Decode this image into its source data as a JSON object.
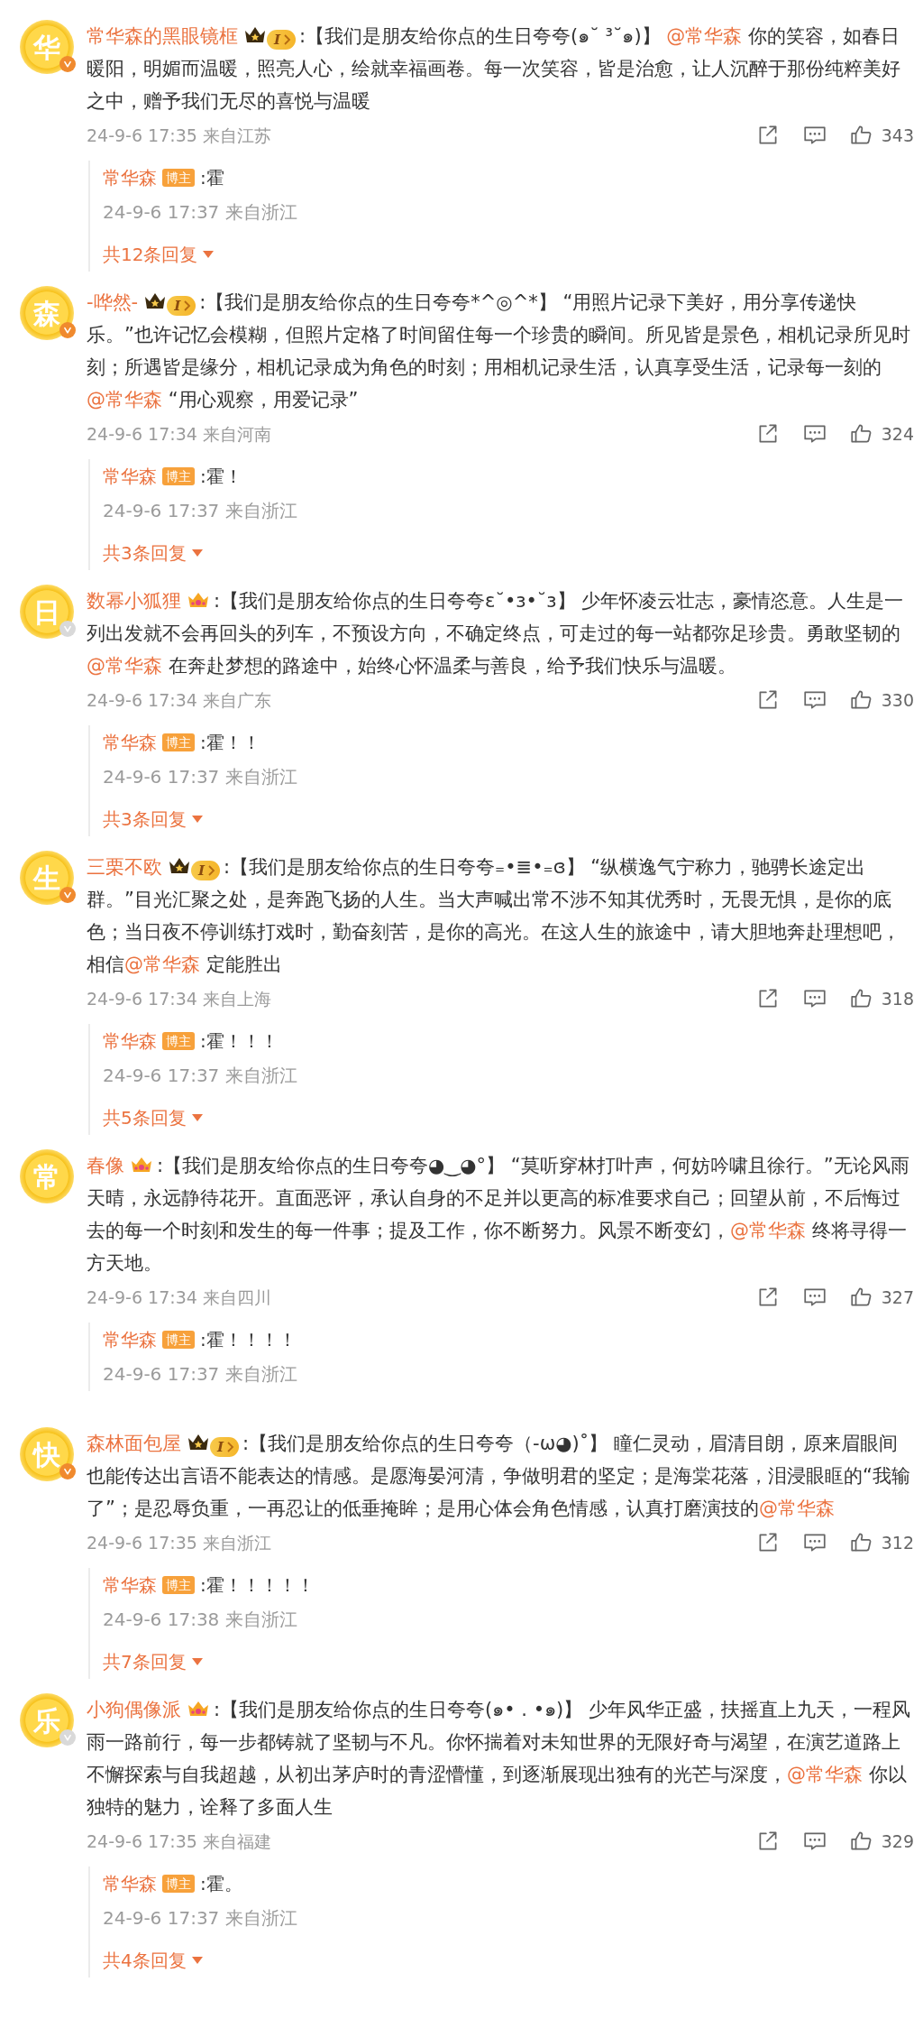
{
  "comments": [
    {
      "avatar": "华",
      "verified": {
        "color": "#f08a2e"
      },
      "name": "常华森的黑眼镜框",
      "badge": {
        "kind": "level",
        "label": "I"
      },
      "body": [
        {
          "kind": "text",
          "text": ":【我们是朋友给你点的生日夸夸(๑˘ ³˘๑)】 "
        },
        {
          "kind": "mention",
          "text": "@常华森"
        },
        {
          "kind": "text",
          "text": " 你的笑容，如春日暖阳，明媚而温暖，照亮人心，绘就幸福画卷。每一次笑容，皆是治愈，让人沉醉于那份纯粹美好之中，赠予我们无尽的喜悦与温暖"
        }
      ],
      "meta": "24-9-6 17:35 来自江苏",
      "likes": "343",
      "reply": {
        "name": "常华森",
        "tag": "博主",
        "text": ":霍",
        "meta": "24-9-6 17:37 来自浙江"
      },
      "more_replies": "共12条回复"
    },
    {
      "avatar": "森",
      "verified": {
        "color": "#f08a2e"
      },
      "name": "-哗然-",
      "badge": {
        "kind": "level",
        "label": "I"
      },
      "body": [
        {
          "kind": "text",
          "text": ":【我们是朋友给你点的生日夸夸*^◎^*】 “用照片记录下美好，用分享传递快乐。”也许记忆会模糊，但照片定格了时间留住每一个珍贵的瞬间。所见皆是景色，相机记录所见时刻；所遇皆是缘分，相机记录成为角色的时刻；用相机记录生活，认真享受生活，记录每一刻的"
        },
        {
          "kind": "mention",
          "text": "@常华森"
        },
        {
          "kind": "text",
          "text": " “用心观察，用爱记录”"
        }
      ],
      "meta": "24-9-6 17:34 来自河南",
      "likes": "324",
      "reply": {
        "name": "常华森",
        "tag": "博主",
        "text": ":霍！",
        "meta": "24-9-6 17:37 来自浙江"
      },
      "more_replies": "共3条回复"
    },
    {
      "avatar": "日",
      "verified": {
        "color": "#d9d9d9"
      },
      "name": "数幂小狐狸",
      "badge": {
        "kind": "crown"
      },
      "body": [
        {
          "kind": "text",
          "text": ":【我们是朋友给你点的生日夸夸ɛ˘•з•˘ɜ】 少年怀凌云壮志，豪情恣意。人生是一列出发就不会再回头的列车，不预设方向，不确定终点，可走过的每一站都弥足珍贵。勇敢坚韧的"
        },
        {
          "kind": "mention",
          "text": "@常华森"
        },
        {
          "kind": "text",
          "text": " 在奔赴梦想的路途中，始终心怀温柔与善良，给予我们快乐与温暖。"
        }
      ],
      "meta": "24-9-6 17:34 来自广东",
      "likes": "330",
      "reply": {
        "name": "常华森",
        "tag": "博主",
        "text": ":霍！！",
        "meta": "24-9-6 17:37 来自浙江"
      },
      "more_replies": "共3条回复"
    },
    {
      "avatar": "生",
      "verified": {
        "color": "#f08a2e"
      },
      "name": "三栗不欧",
      "badge": {
        "kind": "level",
        "label": "I"
      },
      "body": [
        {
          "kind": "text",
          "text": ":【我们是朋友给你点的生日夸夸₌•≣•₌ɞ】 “纵横逸气宁称力，驰骋长途定出群。”目光汇聚之处，是奔跑飞扬的人生。当大声喊出常不涉不知其优秀时，无畏无惧，是你的底色；当日夜不停训练打戏时，勤奋刻苦，是你的高光。在这人生的旅途中，请大胆地奔赴理想吧，相信"
        },
        {
          "kind": "mention",
          "text": "@常华森"
        },
        {
          "kind": "text",
          "text": " 定能胜出"
        }
      ],
      "meta": "24-9-6 17:34 来自上海",
      "likes": "318",
      "reply": {
        "name": "常华森",
        "tag": "博主",
        "text": ":霍！！！",
        "meta": "24-9-6 17:37 来自浙江"
      },
      "more_replies": "共5条回复"
    },
    {
      "avatar": "常",
      "name": "春像",
      "badge": {
        "kind": "crown"
      },
      "body": [
        {
          "kind": "text",
          "text": ":【我们是朋友给你点的生日夸夸◕‿◕°】 “莫听穿林打叶声，何妨吟啸且徐行。”无论风雨天晴，永远静待花开。直面恶评，承认自身的不足并以更高的标准要求自己；回望从前，不后悔过去的每一个时刻和发生的每一件事；提及工作，你不断努力。风景不断变幻，"
        },
        {
          "kind": "mention",
          "text": "@常华森"
        },
        {
          "kind": "text",
          "text": " 终将寻得一方天地。"
        }
      ],
      "meta": "24-9-6 17:34 来自四川",
      "likes": "327",
      "reply": {
        "name": "常华森",
        "tag": "博主",
        "text": ":霍！！！！",
        "meta": "24-9-6 17:37 来自浙江"
      }
    },
    {
      "avatar": "快",
      "verified": {
        "color": "#f08a2e"
      },
      "name": "森林面包屋",
      "badge": {
        "kind": "level",
        "label": "I"
      },
      "body": [
        {
          "kind": "text",
          "text": ":【我们是朋友给你点的生日夸夸（-ω◕)˚】 瞳仁灵动，眉清目朗，原来眉眼间也能传达出言语不能表达的情感。是愿海晏河清，争做明君的坚定；是海棠花落，泪浸眼眶的“我输了”；是忍辱负重，一再忍让的低垂掩眸；是用心体会角色情感，认真打磨演技的"
        },
        {
          "kind": "mention",
          "text": "@常华森"
        }
      ],
      "meta": "24-9-6 17:35 来自浙江",
      "likes": "312",
      "reply": {
        "name": "常华森",
        "tag": "博主",
        "text": ":霍！！！！！",
        "meta": "24-9-6 17:38 来自浙江"
      },
      "more_replies": "共7条回复"
    },
    {
      "avatar": "乐",
      "verified": {
        "color": "#d9d9d9"
      },
      "name": "小狗偶像派",
      "badge": {
        "kind": "crown"
      },
      "body": [
        {
          "kind": "text",
          "text": ":【我们是朋友给你点的生日夸夸(๑• . •๑)】 少年风华正盛，扶摇直上九天，一程风雨一路前行，每一步都铸就了坚韧与不凡。你怀揣着对未知世界的无限好奇与渴望，在演艺道路上不懈探索与自我超越，从初出茅庐时的青涩懵懂，到逐渐展现出独有的光芒与深度，"
        },
        {
          "kind": "mention",
          "text": "@常华森"
        },
        {
          "kind": "text",
          "text": " 你以独特的魅力，诠释了多面人生"
        }
      ],
      "meta": "24-9-6 17:35 来自福建",
      "likes": "329",
      "reply": {
        "name": "常华森",
        "tag": "博主",
        "text": ":霍。",
        "meta": "24-9-6 17:37 来自浙江"
      },
      "more_replies": "共4条回复"
    }
  ]
}
